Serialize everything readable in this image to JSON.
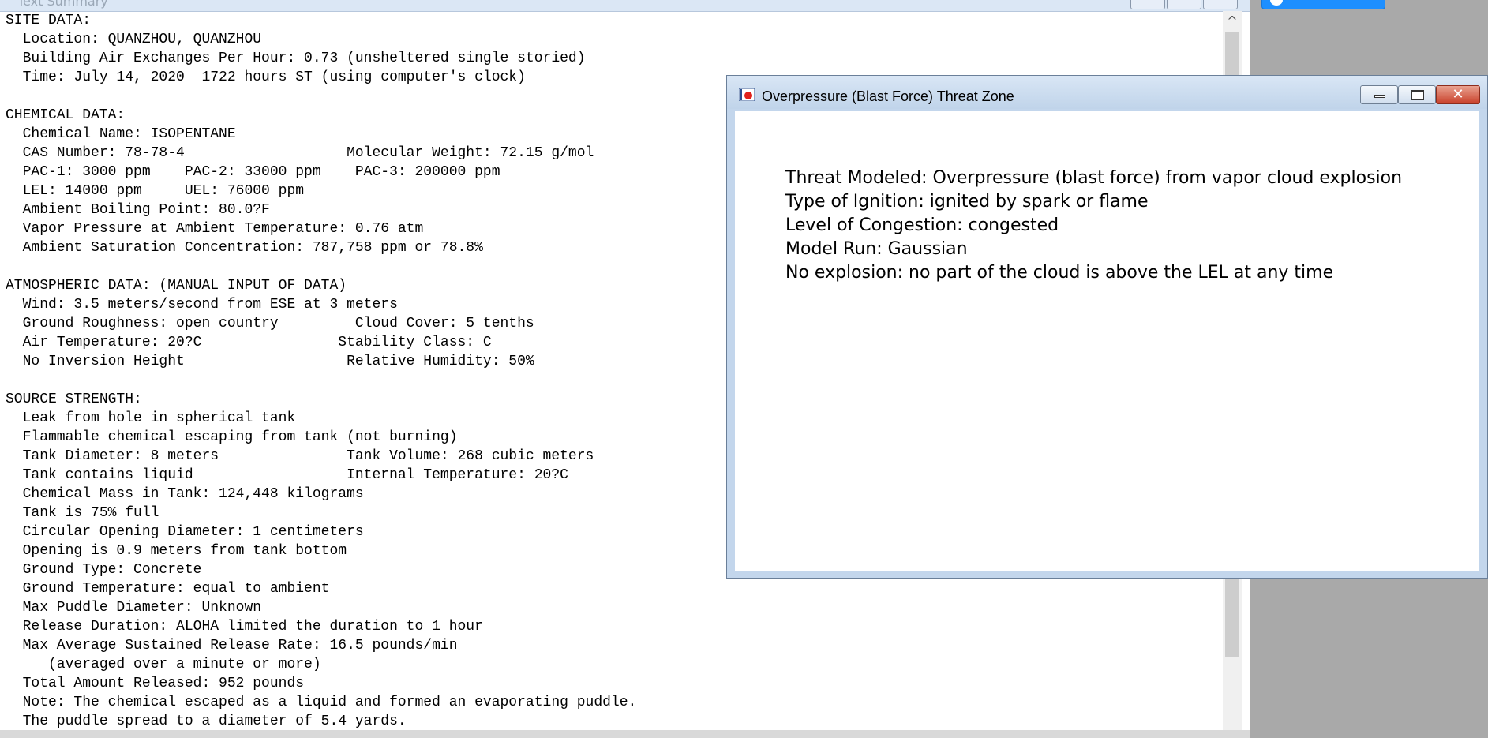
{
  "summary_window": {
    "title": "Text Summary",
    "lines": [
      "SITE DATA:",
      "  Location: QUANZHOU, QUANZHOU",
      "  Building Air Exchanges Per Hour: 0.73 (unsheltered single storied)",
      "  Time: July 14, 2020  1722 hours ST (using computer's clock)",
      "",
      "CHEMICAL DATA:",
      "  Chemical Name: ISOPENTANE",
      "  CAS Number: 78-78-4                   Molecular Weight: 72.15 g/mol",
      "  PAC-1: 3000 ppm    PAC-2: 33000 ppm    PAC-3: 200000 ppm",
      "  LEL: 14000 ppm     UEL: 76000 ppm",
      "  Ambient Boiling Point: 80.0?F",
      "  Vapor Pressure at Ambient Temperature: 0.76 atm",
      "  Ambient Saturation Concentration: 787,758 ppm or 78.8%",
      "",
      "ATMOSPHERIC DATA: (MANUAL INPUT OF DATA)",
      "  Wind: 3.5 meters/second from ESE at 3 meters",
      "  Ground Roughness: open country         Cloud Cover: 5 tenths",
      "  Air Temperature: 20?C                Stability Class: C",
      "  No Inversion Height                   Relative Humidity: 50%",
      "",
      "SOURCE STRENGTH:",
      "  Leak from hole in spherical tank",
      "  Flammable chemical escaping from tank (not burning)",
      "  Tank Diameter: 8 meters               Tank Volume: 268 cubic meters",
      "  Tank contains liquid                  Internal Temperature: 20?C",
      "  Chemical Mass in Tank: 124,448 kilograms",
      "  Tank is 75% full",
      "  Circular Opening Diameter: 1 centimeters",
      "  Opening is 0.9 meters from tank bottom",
      "  Ground Type: Concrete",
      "  Ground Temperature: equal to ambient",
      "  Max Puddle Diameter: Unknown",
      "  Release Duration: ALOHA limited the duration to 1 hour",
      "  Max Average Sustained Release Rate: 16.5 pounds/min",
      "     (averaged over a minute or more)",
      "  Total Amount Released: 952 pounds",
      "  Note: The chemical escaped as a liquid and formed an evaporating puddle.",
      "  The puddle spread to a diameter of 5.4 yards."
    ],
    "scroll_up_glyph": "^"
  },
  "threat_window": {
    "title": "Overpressure (Blast Force) Threat Zone",
    "close_glyph": "✕",
    "lines": [
      "Threat Modeled: Overpressure (blast force) from vapor cloud explosion",
      "Type of Ignition: ignited by spark or flame",
      "Level of Congestion: congested",
      "Model Run: Gaussian",
      "No explosion: no part of the cloud is above the LEL at any time"
    ]
  },
  "colors": {
    "desktop": "#a9a9a9",
    "dialog_frame": "#c3d6ec",
    "close_button": "#c9412b",
    "accent_button": "#1e8fff"
  },
  "icons": [
    "app-icon",
    "minimize-icon",
    "maximize-icon",
    "close-icon",
    "scroll-up-icon"
  ]
}
